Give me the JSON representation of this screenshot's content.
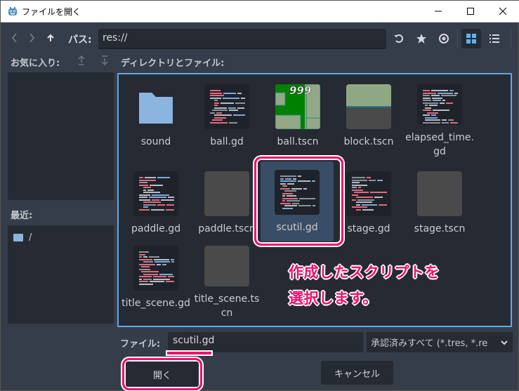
{
  "window": {
    "title": "ファイルを開く",
    "controls": [
      "minimize",
      "maximize",
      "close"
    ]
  },
  "toolbar": {
    "back_icon": "chevron-left-icon",
    "forward_icon": "chevron-right-icon",
    "up_icon": "arrow-up-icon",
    "path_label": "パス:",
    "path_value": "res://",
    "refresh_icon": "refresh-icon",
    "favorite_icon": "star-icon",
    "hidden_toggle_icon": "eye-icon",
    "grid_view_icon": "grid-icon",
    "list_view_icon": "list-icon",
    "active_view": "grid"
  },
  "favorites": {
    "label": "お気に入り:",
    "move_up_icon": "arrow-up-icon",
    "move_down_icon": "arrow-down-icon",
    "items": []
  },
  "recent": {
    "label": "最近:",
    "items": [
      {
        "name": "/",
        "icon": "folder-icon"
      }
    ]
  },
  "files": {
    "label": "ディレクトリとファイル:",
    "items": [
      {
        "name": "sound",
        "type": "folder"
      },
      {
        "name": "ball.gd",
        "type": "script"
      },
      {
        "name": "ball.tscn",
        "type": "scene-preview",
        "preview_text": "999"
      },
      {
        "name": "block.tscn",
        "type": "scene-preview"
      },
      {
        "name": "elapsed_time.gd",
        "type": "script"
      },
      {
        "name": "paddle.gd",
        "type": "script"
      },
      {
        "name": "paddle.tscn",
        "type": "scene-empty"
      },
      {
        "name": "scutil.gd",
        "type": "script",
        "selected": true
      },
      {
        "name": "stage.gd",
        "type": "script"
      },
      {
        "name": "stage.tscn",
        "type": "scene-empty"
      },
      {
        "name": "title_scene.gd",
        "type": "script"
      },
      {
        "name": "title_scene.tscn",
        "type": "scene-empty"
      }
    ]
  },
  "annotation": {
    "line1": "作成したスクリプトを",
    "line2": "選択します。",
    "color": "#f0116e"
  },
  "bottom": {
    "file_label": "ファイル:",
    "file_value": "scutil.gd",
    "filter_value": "承認済みすべて (*.tres, *.re",
    "open_label": "開く",
    "cancel_label": "キャンセル"
  },
  "colors": {
    "accent": "#5fa9eb",
    "panel_bg": "#363d4a",
    "field_bg": "#252a33",
    "selected_bg": "#3a4d66",
    "highlight": "#f0116e"
  }
}
